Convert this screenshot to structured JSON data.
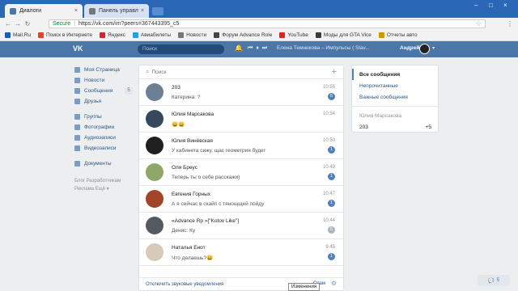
{
  "browser": {
    "tabs": [
      {
        "label": "Диалоги",
        "close": "×"
      },
      {
        "label": "Панель управления пр...",
        "close": "×"
      }
    ],
    "window_controls": {
      "minimize": "–",
      "maximize": "□",
      "close": "×"
    },
    "nav": {
      "back": "←",
      "forward": "→",
      "reload": "↻"
    },
    "secure_label": "Secure",
    "url": "https://vk.com/im?peers=367443395_c5",
    "bookmarks": [
      {
        "label": "Mail.Ru",
        "color": "#1a5fb4"
      },
      {
        "label": "Поиск в Интернете",
        "color": "#e4422a"
      },
      {
        "label": "Яндекс",
        "color": "#d8232a"
      },
      {
        "label": "Авиабилеты",
        "color": "#2a9de0"
      },
      {
        "label": "Новости",
        "color": "#777777"
      },
      {
        "label": "Форум Advance Role",
        "color": "#444444"
      },
      {
        "label": "YouTube",
        "color": "#e62117"
      },
      {
        "label": "Моды для GTA Vice",
        "color": "#3a3a3a"
      },
      {
        "label": "Отчеты авто",
        "color": "#c99a00"
      }
    ]
  },
  "vk": {
    "logo": "VK",
    "search_placeholder": "Поиск",
    "track": "Елена Темникова – Импульсы ( Slav...",
    "username": "Андрей",
    "menu": [
      {
        "label": "Моя Страница"
      },
      {
        "label": "Новости"
      },
      {
        "label": "Сообщения",
        "badge": "5"
      },
      {
        "label": "Друзья"
      },
      {
        "label": "Группы"
      },
      {
        "label": "Фотографии"
      },
      {
        "label": "Аудиозаписи"
      },
      {
        "label": "Видеозаписи"
      },
      {
        "label": "Документы"
      }
    ],
    "footer_links": {
      "row1": "Блог  Разработчикам",
      "row2": "Реклама  Ещё ▾"
    },
    "dialogs_search_placeholder": "Поиск",
    "dialogs": [
      {
        "name": "203",
        "text": "Катерина: ?",
        "time": "10:55",
        "count": "5",
        "avatar": "#6d7f94"
      },
      {
        "name": "Юлия Марсакова",
        "text": "😄😄",
        "time": "10:54",
        "count": "",
        "avatar": "#35485c"
      },
      {
        "name": "Юлия Винёвская",
        "text": "У кабинета сижу, щас геометрия будет",
        "time": "10:50",
        "count": "1",
        "avatar": "#1f1f1f"
      },
      {
        "name": "Оля Бреус",
        "text": "Теперь ты о себе расскажи)",
        "time": "10:49",
        "count": "1",
        "avatar": "#8fa86a"
      },
      {
        "name": "Евгения Горных",
        "text": "А я сейчас в скайп с тянощщей пойду",
        "time": "10:47",
        "count": "1",
        "avatar": "#a0442a"
      },
      {
        "name": "«Advance Rp »[\"Kotov Like\"]",
        "text": "Денис: Ку",
        "time": "10:44",
        "count": "5",
        "avatar": "#555a60",
        "grey": true
      },
      {
        "name": "Наталья Енот",
        "text": "Что делаешь?😄",
        "time": "9:45",
        "count": "1",
        "avatar": "#d8c9b8"
      }
    ],
    "footer_mute": "Отключить звуковые уведомления",
    "footer_spam": "Спам",
    "tooltip": "Изменения",
    "filters": [
      {
        "label": "Все сообщения",
        "active": true
      },
      {
        "label": "Непрочитанные"
      },
      {
        "label": "Важные сообщения"
      }
    ],
    "recent_label": "Юлия Марсакова",
    "recent_item": {
      "label": "203",
      "count": "+5"
    },
    "chat_button": "5"
  }
}
